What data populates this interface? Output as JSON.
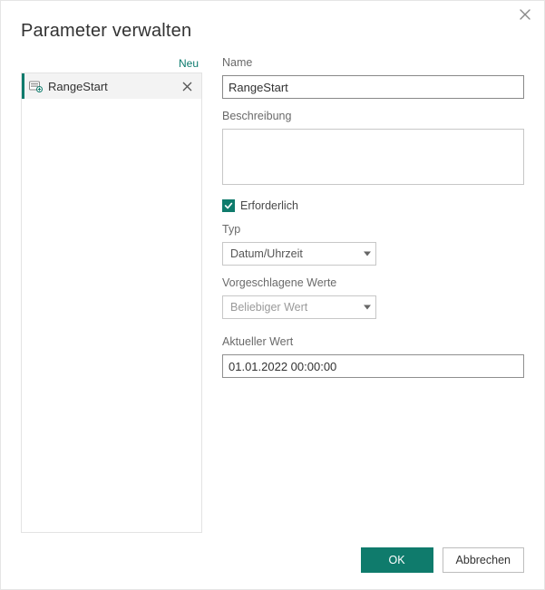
{
  "dialog": {
    "title": "Parameter verwalten"
  },
  "left": {
    "new_link": "Neu",
    "items": [
      {
        "label": "RangeStart"
      }
    ]
  },
  "form": {
    "name_label": "Name",
    "name_value": "RangeStart",
    "desc_label": "Beschreibung",
    "desc_value": "",
    "required_checked": true,
    "required_label": "Erforderlich",
    "type_label": "Typ",
    "type_value": "Datum/Uhrzeit",
    "suggested_label": "Vorgeschlagene Werte",
    "suggested_value": "Beliebiger Wert",
    "current_label": "Aktueller Wert",
    "current_value": "01.01.2022 00:00:00"
  },
  "footer": {
    "ok": "OK",
    "cancel": "Abbrechen"
  }
}
